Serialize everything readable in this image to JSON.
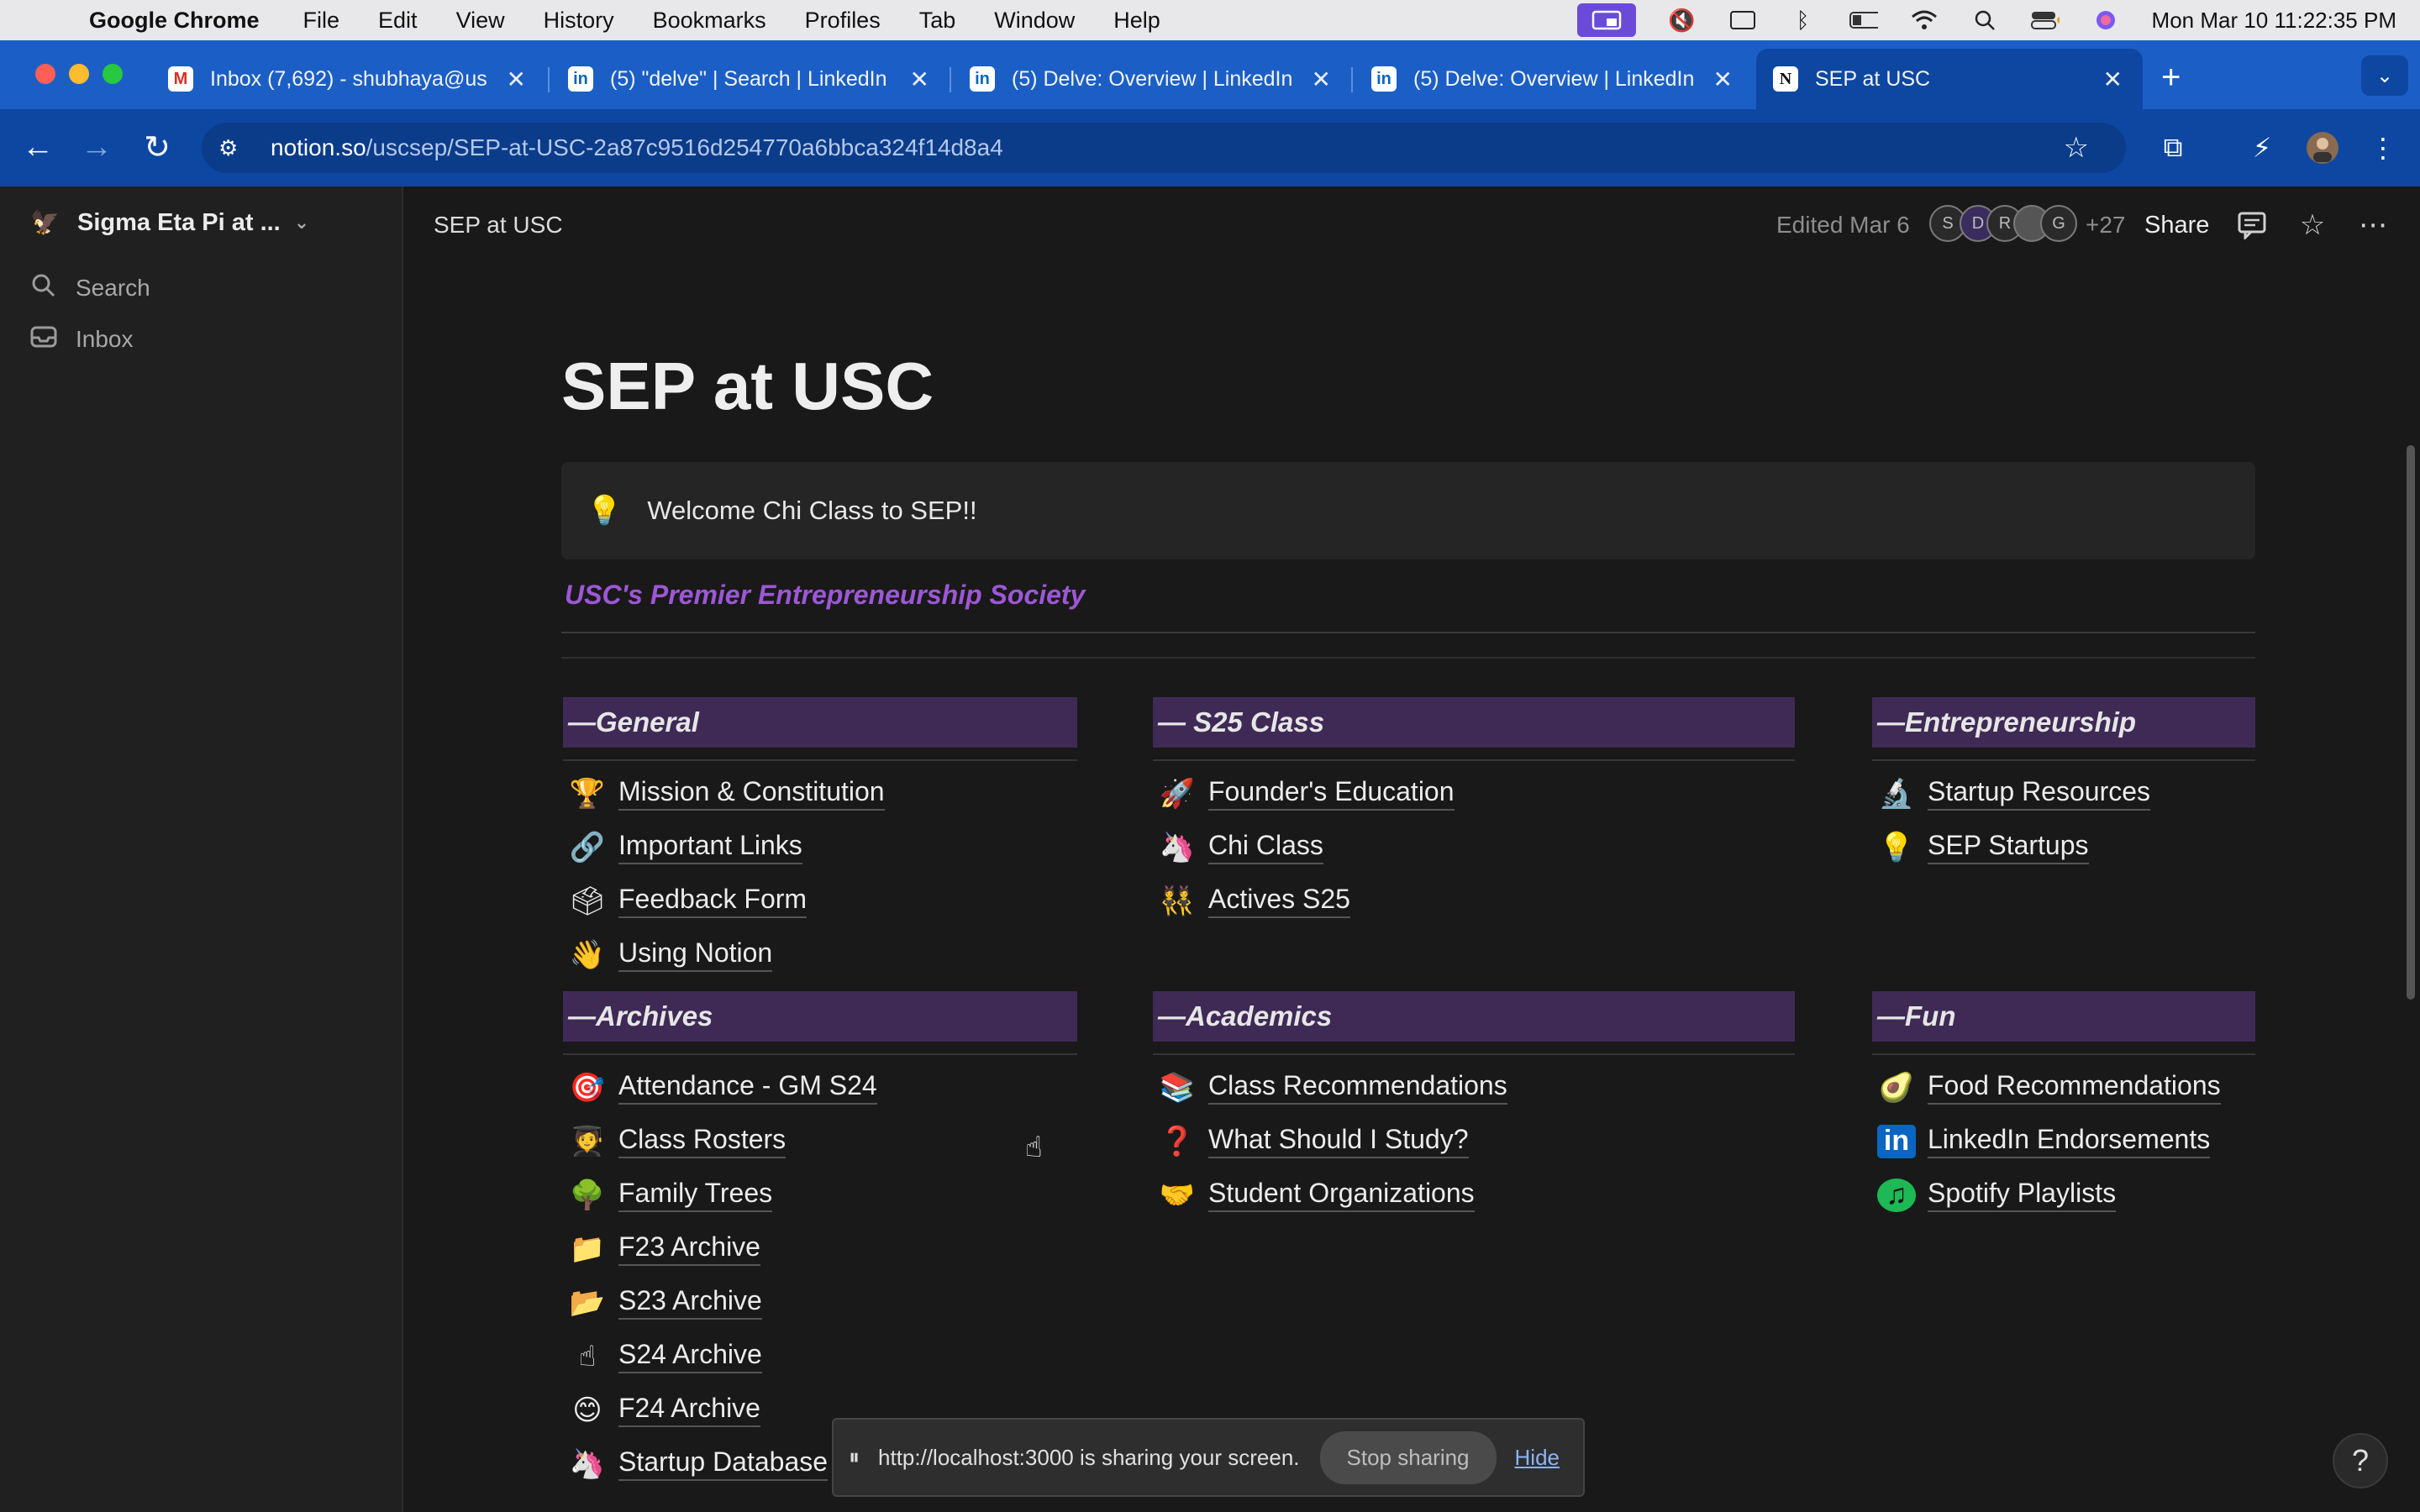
{
  "menubar": {
    "app": "Google Chrome",
    "items": [
      "File",
      "Edit",
      "View",
      "History",
      "Bookmarks",
      "Profiles",
      "Tab",
      "Window",
      "Help"
    ],
    "clock": "Mon Mar 10  11:22:35 PM"
  },
  "tabs": [
    {
      "title": "Inbox (7,692) - shubhaya@us",
      "icon": "gmail-icon"
    },
    {
      "title": "(5) \"delve\" | Search | LinkedIn",
      "icon": "linkedin-icon"
    },
    {
      "title": "(5) Delve: Overview | LinkedIn",
      "icon": "linkedin-icon"
    },
    {
      "title": "(5) Delve: Overview | LinkedIn",
      "icon": "linkedin-icon"
    },
    {
      "title": "SEP at USC",
      "icon": "notion-icon",
      "active": true
    }
  ],
  "address": {
    "host": "notion.so",
    "path": "/uscsep/SEP-at-USC-2a87c9516d254770a6bbca324f14d8a4"
  },
  "sidebar": {
    "workspace": "Sigma Eta Pi at ...",
    "items": [
      {
        "label": "Search",
        "icon": "search-icon"
      },
      {
        "label": "Inbox",
        "icon": "inbox-icon"
      }
    ]
  },
  "topbar": {
    "breadcrumb": "SEP at USC",
    "edited": "Edited Mar 6",
    "avatars": [
      "S",
      "D",
      "R",
      "",
      "G"
    ],
    "more_count": "+27",
    "share": "Share"
  },
  "page": {
    "title": "SEP at USC",
    "callout": "Welcome Chi Class to SEP!!",
    "tagline": "USC's Premier Entrepreneurship Society",
    "sections": [
      {
        "heading": "—General",
        "links": [
          {
            "emoji": "🏆",
            "label": "Mission & Constitution"
          },
          {
            "emoji": "🔗",
            "label": "Important Links"
          },
          {
            "emoji": "🗳",
            "label": "Feedback Form"
          },
          {
            "emoji": "👋",
            "label": "Using Notion"
          }
        ]
      },
      {
        "heading": "— S25 Class",
        "links": [
          {
            "emoji": "🚀",
            "label": "Founder's Education"
          },
          {
            "emoji": "🦄",
            "label": "Chi Class"
          },
          {
            "emoji": "👯",
            "label": "Actives S25"
          }
        ]
      },
      {
        "heading": "—Entrepreneurship",
        "links": [
          {
            "emoji": "🔬",
            "label": "Startup Resources"
          },
          {
            "emoji": "💡",
            "label": "SEP Startups"
          }
        ]
      },
      {
        "heading": "—Archives",
        "links": [
          {
            "emoji": "🎯",
            "label": "Attendance - GM S24"
          },
          {
            "emoji": "🧑‍🎓",
            "label": "Class Rosters"
          },
          {
            "emoji": "🌳",
            "label": "Family Trees"
          },
          {
            "emoji": "📁",
            "label": "F23 Archive"
          },
          {
            "emoji": "📂",
            "label": "S23 Archive"
          },
          {
            "emoji": "☝",
            "label": "S24 Archive"
          },
          {
            "emoji": "😊",
            "label": "F24 Archive"
          },
          {
            "emoji": "🦄",
            "label": "Startup Database"
          }
        ]
      },
      {
        "heading": "—Academics",
        "links": [
          {
            "emoji": "📚",
            "label": "Class Recommendations"
          },
          {
            "emoji": "❓",
            "label": "What Should I Study?"
          },
          {
            "emoji": "🤝",
            "label": "Student Organizations"
          }
        ]
      },
      {
        "heading": "—Fun",
        "links": [
          {
            "emoji": "🥑",
            "label": "Food Recommendations"
          },
          {
            "emoji": "in",
            "label": "LinkedIn Endorsements"
          },
          {
            "emoji": "♫",
            "label": "Spotify Playlists"
          }
        ]
      }
    ]
  },
  "sharing": {
    "message": "http://localhost:3000 is sharing your screen.",
    "stop": "Stop sharing",
    "hide": "Hide"
  },
  "help": "?",
  "colors": {
    "accent": "#9d57d6",
    "section_bg": "#3f2a56",
    "chrome_blue": "#1b5fc6"
  }
}
